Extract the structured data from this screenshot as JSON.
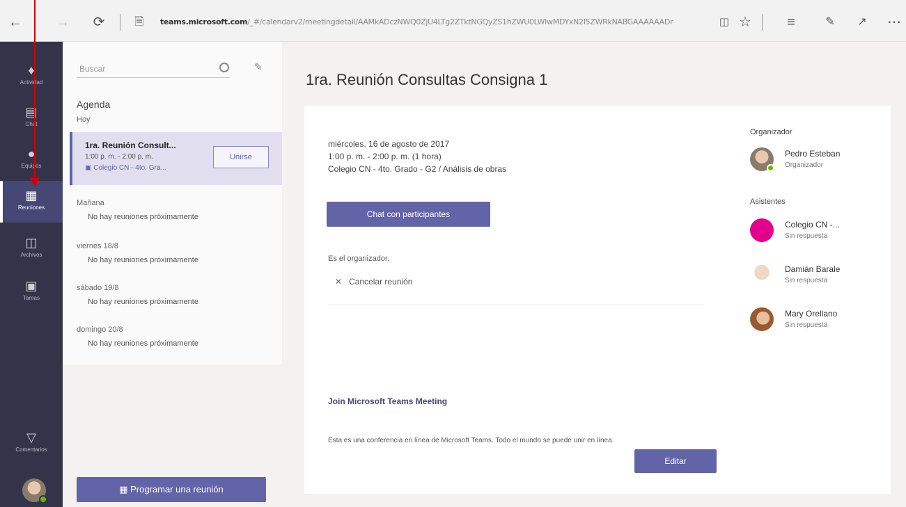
{
  "browser": {
    "url_host": "teams.microsoft.com",
    "url_path": "/_#/calendarv2/meetingdetail/AAMkADczNWQ0ZjU4LTg2ZTktNGQyZS1hZWU0LWIwMDYxN2I5ZWRkNABGAAAAAADr",
    "icons": [
      "back-icon",
      "forward-icon",
      "refresh-icon",
      "page-icon",
      "reading-view-icon",
      "favorite-star-icon",
      "hub-icon",
      "annotate-icon",
      "share-icon",
      "more-icon"
    ]
  },
  "rail": {
    "items": [
      {
        "label": "Actividad",
        "icon": "bell-icon"
      },
      {
        "label": "Chat",
        "icon": "chat-icon"
      },
      {
        "label": "Equipos",
        "icon": "teams-icon"
      },
      {
        "label": "Reuniones",
        "icon": "calendar-icon"
      },
      {
        "label": "Archivos",
        "icon": "files-icon"
      },
      {
        "label": "Tareas",
        "icon": "tasks-icon"
      }
    ],
    "bottom_label": "Comentarios"
  },
  "list": {
    "search_placeholder": "Buscar",
    "agenda_title": "Agenda",
    "today_label": "Hoy",
    "meeting": {
      "title": "1ra. Reunión Consult...",
      "time": "1:00 p. m. - 2:00 p. m.",
      "channel": "Colegio CN - 4to. Gra...",
      "join_label": "Unirse"
    },
    "days": [
      {
        "day": "Mañana",
        "none": "No hay reuniones próximamente"
      },
      {
        "day": "viernes 18/8",
        "none": "No hay reuniones próximamente"
      },
      {
        "day": "sábado 19/8",
        "none": "No hay reuniones próximamente"
      },
      {
        "day": "domingo 20/8",
        "none": "No hay reuniones próximamente"
      }
    ],
    "schedule_label": "Programar una reunión"
  },
  "main": {
    "title": "1ra. Reunión Consultas Consigna 1",
    "date": "miércoles, 16 de agosto de 2017",
    "time": "1:00 p. m. - 2:00 p. m. (1 hora)",
    "location": "Colegio CN - 4to. Grado - G2 / Análisis de obras",
    "chat_label": "Chat con participantes",
    "organizer_note": "Es el organizador.",
    "cancel_label": "Cancelar reunión",
    "join_link": "Join Microsoft Teams Meeting",
    "description": "Esta es una conferencia en línea de Microsoft Teams. Todo el mundo se puede unir en línea.",
    "edit_label": "Editar",
    "organizer_head": "Organizador",
    "organizer": {
      "name": "Pedro Esteban",
      "role": "Organizador"
    },
    "attendees_head": "Asistentes",
    "attendees": [
      {
        "name": "Colegio CN -...",
        "role": "Sin respuesta",
        "color": "#e3008c"
      },
      {
        "name": "Damián Barale",
        "role": "Sin respuesta",
        "color": "#d9c3ae"
      },
      {
        "name": "Mary Orellano",
        "role": "Sin respuesta",
        "color": "#b5794f"
      }
    ]
  },
  "colors": {
    "accent": "#6264a7",
    "rail": "#33344a",
    "annotation": "#d40000"
  }
}
